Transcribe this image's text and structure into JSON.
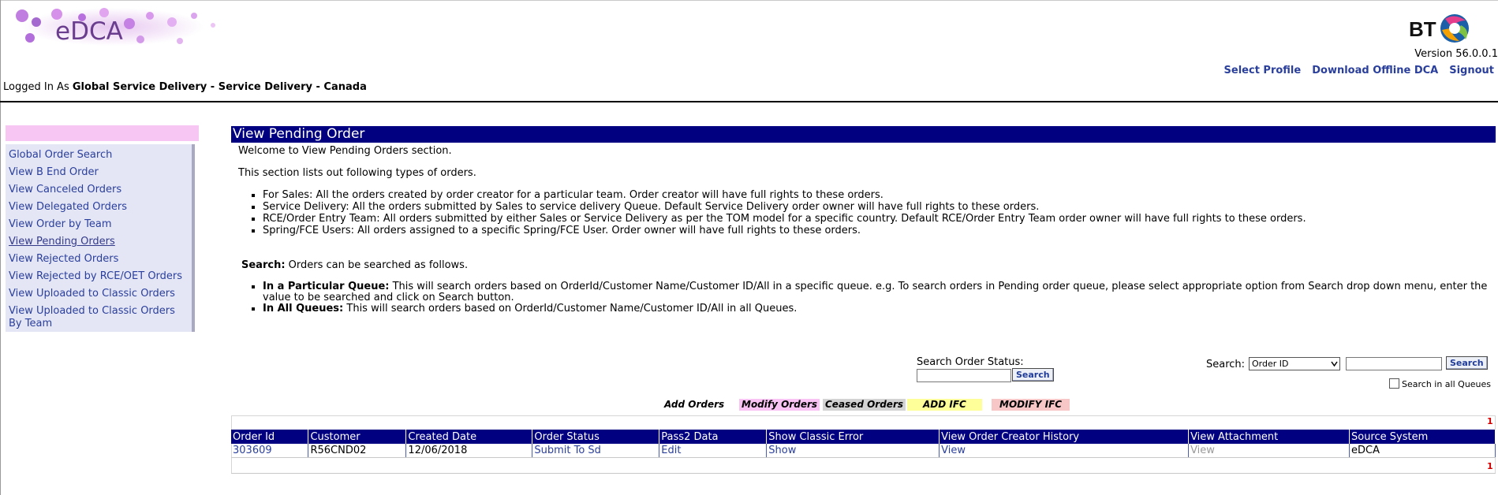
{
  "header": {
    "app_name": "eDCA",
    "version": "Version 56.0.0.1",
    "links": [
      "Select Profile",
      "Download Offline DCA",
      "Signout"
    ],
    "logged_in_prefix": "Logged In As",
    "logged_in_user": "Global Service Delivery - Service Delivery - Canada"
  },
  "sidebar": {
    "items": [
      {
        "label": "Global Order Search"
      },
      {
        "label": "View B End Order"
      },
      {
        "label": "View Canceled Orders"
      },
      {
        "label": "View Delegated Orders"
      },
      {
        "label": "View Order by Team"
      },
      {
        "label": "View Pending Orders"
      },
      {
        "label": "View Rejected Orders"
      },
      {
        "label": "View Rejected by RCE/OET Orders"
      },
      {
        "label": "View Uploaded to Classic Orders"
      },
      {
        "label": "View Uploaded to Classic Orders By Team"
      }
    ]
  },
  "main": {
    "title": "View Pending Order",
    "welcome": "Welcome to View Pending Orders section.",
    "intro": "This section lists out following types of orders.",
    "order_types": [
      "For Sales: All the orders created by order creator for a particular team. Order creator will have full rights to these orders.",
      "Service Delivery: All the orders submitted by Sales to service delivery Queue. Default Service Delivery order owner will have full rights to these orders.",
      "RCE/Order Entry Team: All orders submitted by either Sales or Service Delivery as per the TOM model for a specific country. Default RCE/Order Entry Team order owner will have full rights to these orders.",
      "Spring/FCE Users: All orders assigned to a specific Spring/FCE User. Order owner will have full rights to these orders."
    ],
    "search_heading": "Search:",
    "search_intro": "Orders can be searched as follows.",
    "search_modes": [
      {
        "title": "In a Particular Queue:",
        "text": "This will search orders based on OrderId/Customer Name/Customer ID/All in a specific queue. e.g. To search orders in Pending order queue, please select appropriate option from Search drop down menu, enter the value to be searched and click on Search button."
      },
      {
        "title": "In All Queues:",
        "text": "This will search orders based on OrderId/Customer Name/Customer ID/All in all Queues."
      }
    ]
  },
  "search": {
    "status_label": "Search Order Status:",
    "status_button": "Search",
    "label": "Search:",
    "selected_option": "Order ID",
    "button": "Search",
    "all_queues_label": "Search in all Queues"
  },
  "legend": {
    "items": [
      {
        "label": "Add Orders",
        "color": "#ffffff"
      },
      {
        "label": "Modify Orders",
        "color": "#f9c3f4"
      },
      {
        "label": "Ceased Orders",
        "color": "#d3d3d3"
      },
      {
        "label": "ADD IFC",
        "color": "#ffff99"
      },
      {
        "label": "MODIFY IFC",
        "color": "#f7c6c6"
      }
    ]
  },
  "table": {
    "count_top": "1",
    "count_bottom": "1",
    "columns": [
      "Order Id",
      "Customer",
      "Created Date",
      "Order Status",
      "Pass2 Data",
      "Show Classic Error",
      "View Order Creator History",
      "View Attachment",
      "Source System"
    ],
    "rows": [
      [
        "303609",
        "R56CND02",
        "12/06/2018",
        "Submit To Sd",
        "Edit",
        "Show",
        "View",
        "View",
        "eDCA"
      ]
    ]
  }
}
